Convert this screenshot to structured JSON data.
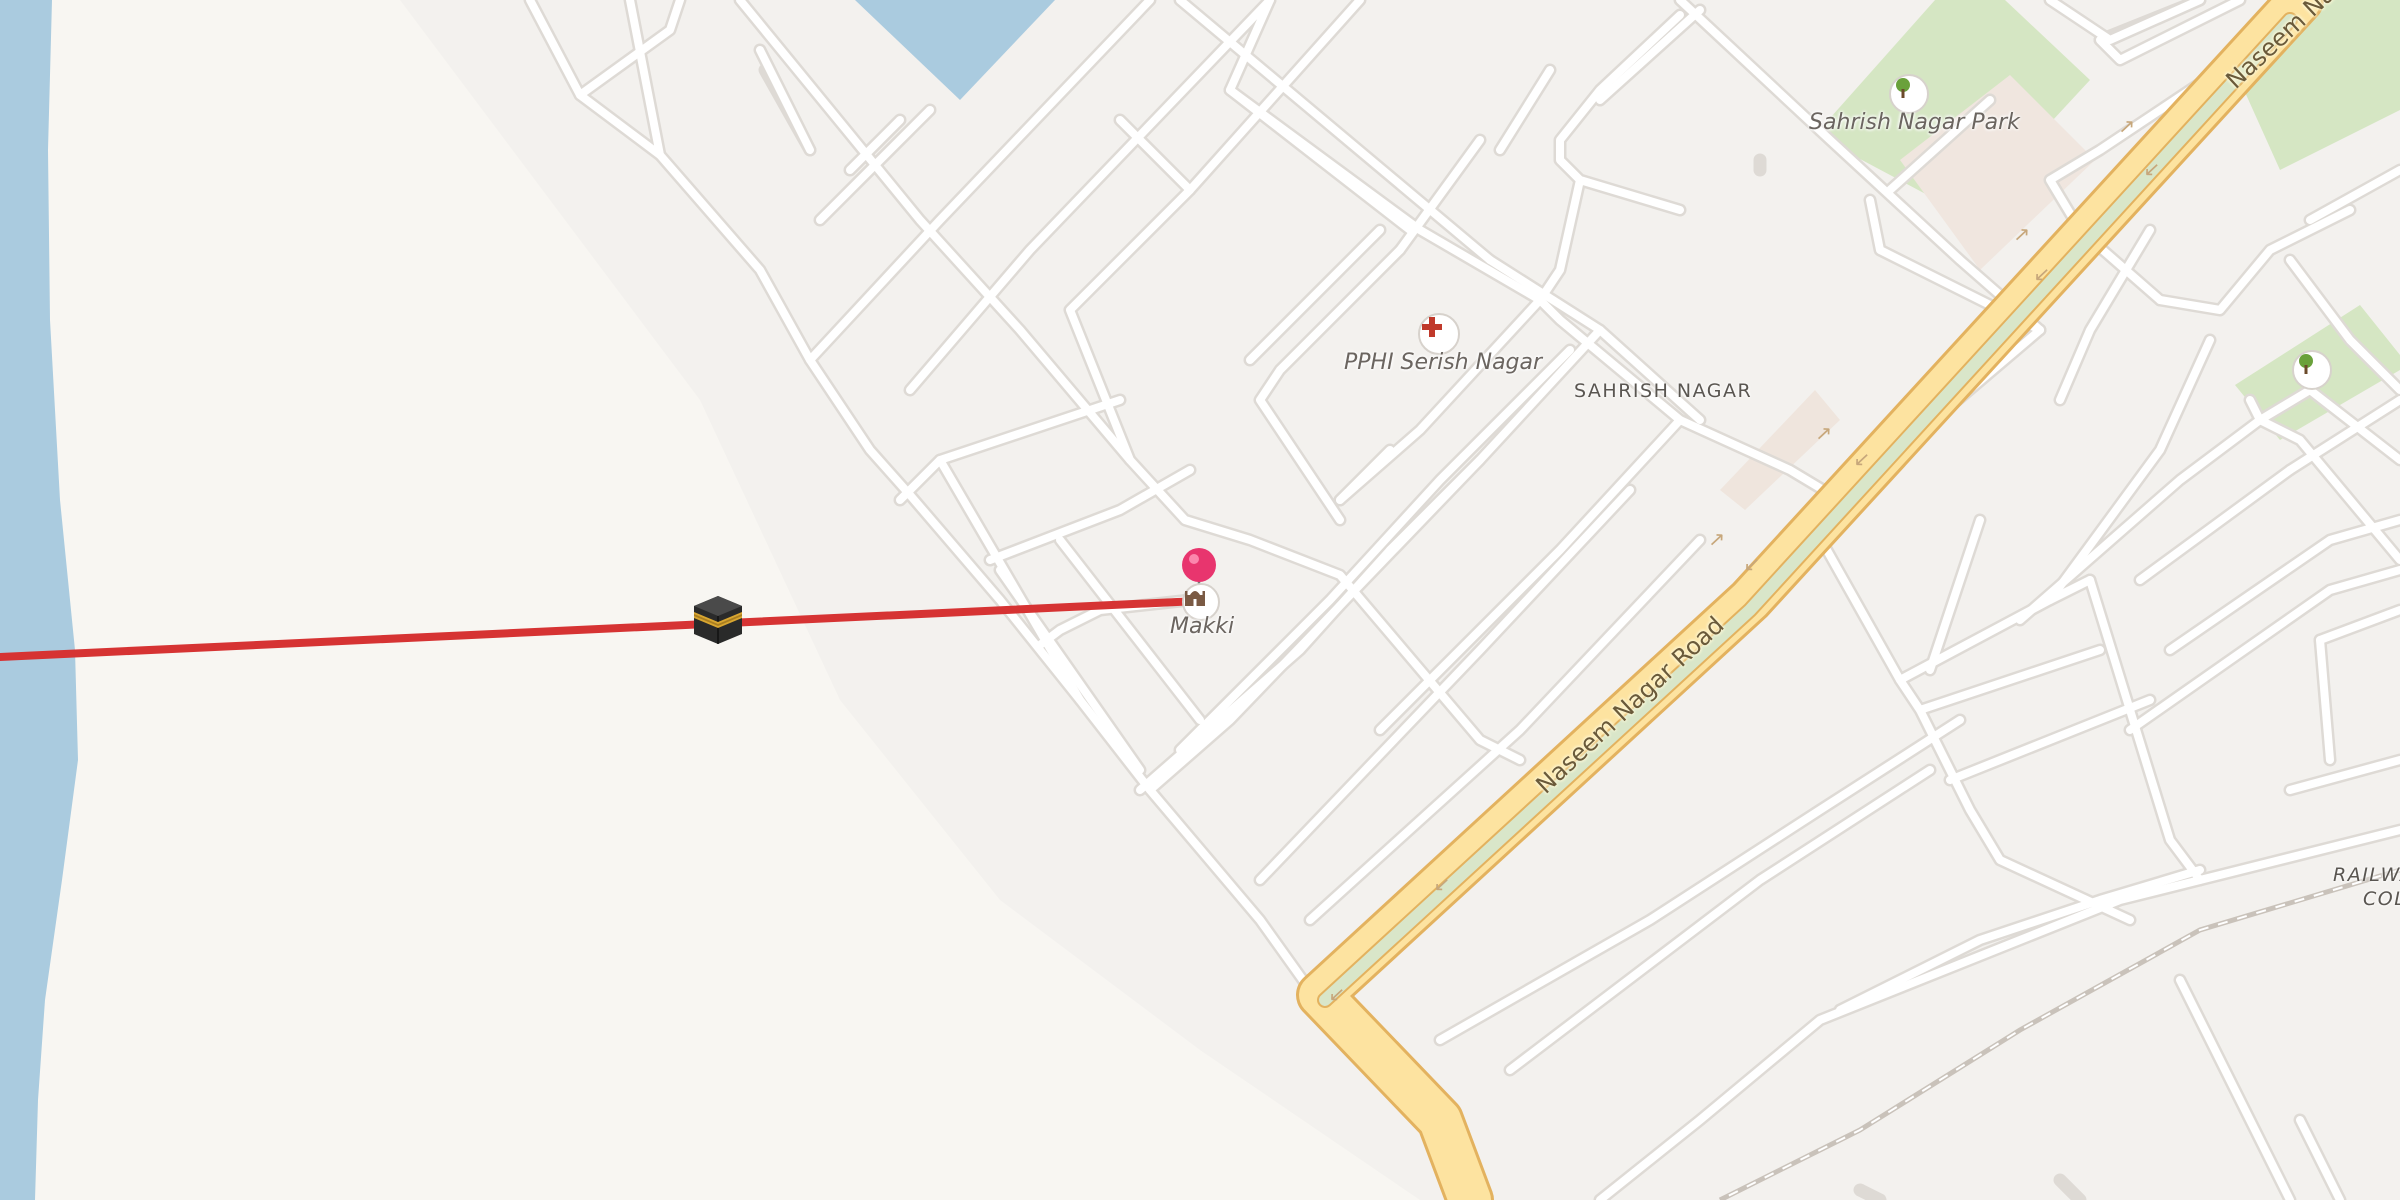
{
  "map": {
    "labels": {
      "park": "Sahrish Nagar Park",
      "clinic": "PPHI Serish Nagar",
      "district": "SAHRISH NAGAR",
      "mosque": "Makki",
      "road_a": "Naseem Nagar Road",
      "road_b": "Naseem Na",
      "railway_1": "RAILWA",
      "railway_2": "COL"
    },
    "icons": {
      "park_icon": "tree-icon",
      "park_icon_2": "tree-icon",
      "clinic_icon": "medical-cross-icon",
      "mosque_icon": "mosque-icon",
      "marker": "location-pin-icon",
      "kaaba": "kaaba-icon"
    },
    "colors": {
      "qibla_line": "#d63333",
      "water": "#aacbdf",
      "land": "#f3f1ee",
      "sand": "#f8f6f2",
      "park": "#d5e6c3",
      "primary_road_casing": "#e3b25f",
      "primary_road_fill": "#fde3a0",
      "median": "#d9e6c9",
      "pin": "#e8356e"
    }
  }
}
